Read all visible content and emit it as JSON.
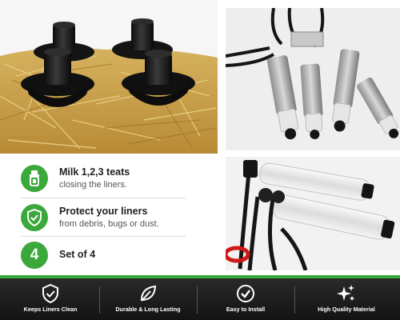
{
  "features": [
    {
      "icon": "teat-cup-icon",
      "title": "Milk 1,2,3 teats",
      "description": "closing the liners."
    },
    {
      "icon": "shield-check-icon",
      "title": "Protect your liners",
      "description": "from debris, bugs or dust."
    },
    {
      "badge_text": "4",
      "title": "Set of 4",
      "description": ""
    }
  ],
  "benefits": [
    {
      "icon": "shield-check-icon",
      "label": "Keeps Liners Clean"
    },
    {
      "icon": "leaf-icon",
      "label": "Durable & Long Lasting"
    },
    {
      "icon": "check-circle-icon",
      "label": "Easy to Install"
    },
    {
      "icon": "sparkle-icon",
      "label": "High Quality Material"
    }
  ],
  "colors": {
    "accent_green": "#3aa83a",
    "bar_dark": "#1c1c1c",
    "plug_black": "#1a1a1a"
  }
}
